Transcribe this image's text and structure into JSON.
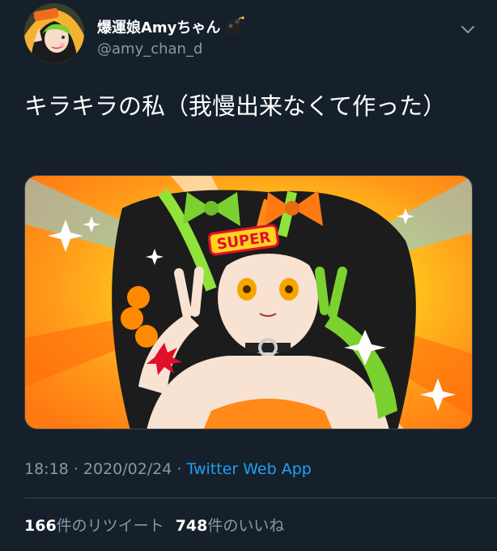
{
  "user": {
    "display_name": "爆運娘Amyちゃん",
    "handle": "@amy_chan_d",
    "avatar_icon": "avatar-amy",
    "badge_icon": "bomb-icon"
  },
  "tweet": {
    "text": "キラキラの私（我慢出来なくて作った）",
    "time": "18:18",
    "separator": " · ",
    "date": "2020/02/24",
    "source": "Twitter Web App"
  },
  "media": {
    "description_icon": "illustration-image",
    "logo_text": "SUPER"
  },
  "stats": {
    "retweets_count": "166",
    "retweets_label": "件のリツイート",
    "likes_count": "748",
    "likes_label": "件のいいね"
  },
  "colors": {
    "background": "#15202b",
    "text": "#ffffff",
    "secondary": "#8899a6",
    "link": "#1da1f2",
    "border": "#38444d"
  }
}
